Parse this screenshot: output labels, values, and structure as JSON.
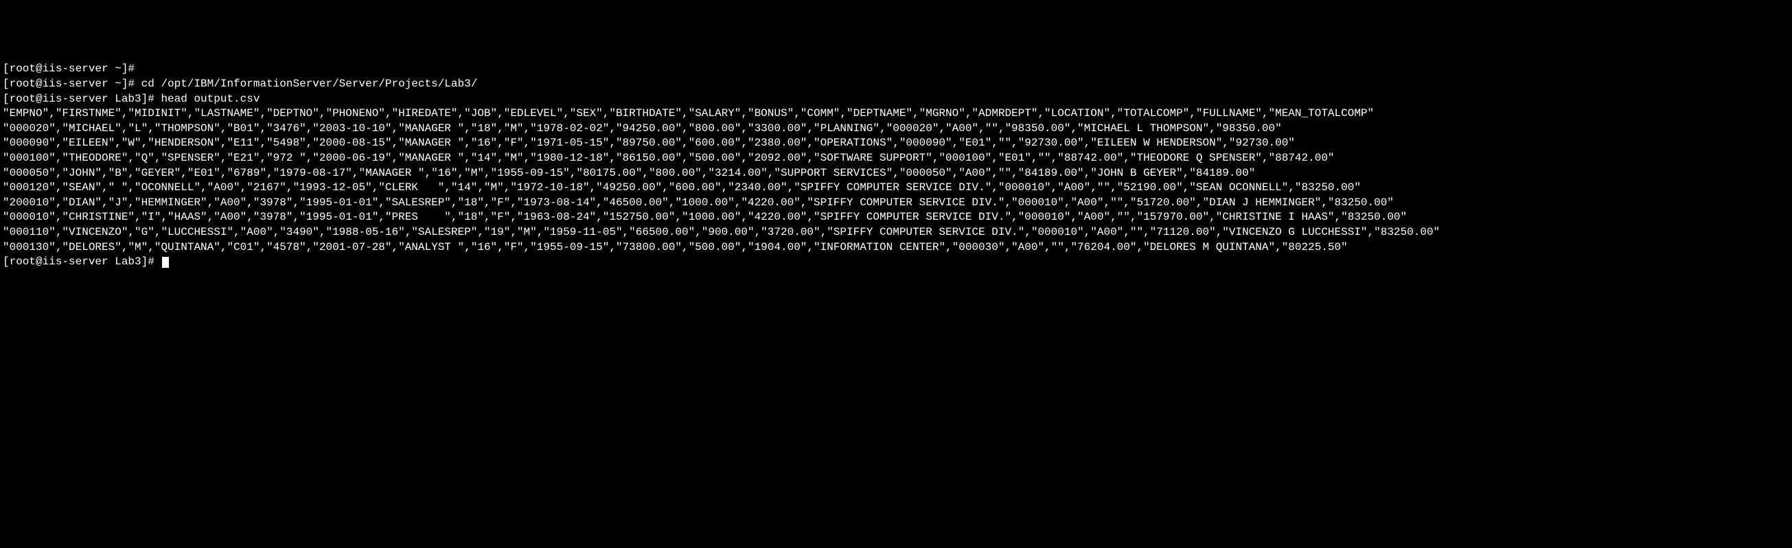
{
  "terminal": {
    "lines": [
      {
        "type": "prompt",
        "text": "[root@iis-server ~]#"
      },
      {
        "type": "prompt",
        "text": "[root@iis-server ~]# cd /opt/IBM/InformationServer/Server/Projects/Lab3/"
      },
      {
        "type": "prompt",
        "text": "[root@iis-server Lab3]# head output.csv"
      },
      {
        "type": "output",
        "text": "\"EMPNO\",\"FIRSTNME\",\"MIDINIT\",\"LASTNAME\",\"DEPTNO\",\"PHONENO\",\"HIREDATE\",\"JOB\",\"EDLEVEL\",\"SEX\",\"BIRTHDATE\",\"SALARY\",\"BONUS\",\"COMM\",\"DEPTNAME\",\"MGRNO\",\"ADMRDEPT\",\"LOCATION\",\"TOTALCOMP\",\"FULLNAME\",\"MEAN_TOTALCOMP\""
      },
      {
        "type": "output",
        "text": "\"000020\",\"MICHAEL\",\"L\",\"THOMPSON\",\"B01\",\"3476\",\"2003-10-10\",\"MANAGER \",\"18\",\"M\",\"1978-02-02\",\"94250.00\",\"800.00\",\"3300.00\",\"PLANNING\",\"000020\",\"A00\",\"\",\"98350.00\",\"MICHAEL L THOMPSON\",\"98350.00\""
      },
      {
        "type": "output",
        "text": "\"000090\",\"EILEEN\",\"W\",\"HENDERSON\",\"E11\",\"5498\",\"2000-08-15\",\"MANAGER \",\"16\",\"F\",\"1971-05-15\",\"89750.00\",\"600.00\",\"2380.00\",\"OPERATIONS\",\"000090\",\"E01\",\"\",\"92730.00\",\"EILEEN W HENDERSON\",\"92730.00\""
      },
      {
        "type": "output",
        "text": "\"000100\",\"THEODORE\",\"Q\",\"SPENSER\",\"E21\",\"972 \",\"2000-06-19\",\"MANAGER \",\"14\",\"M\",\"1980-12-18\",\"86150.00\",\"500.00\",\"2092.00\",\"SOFTWARE SUPPORT\",\"000100\",\"E01\",\"\",\"88742.00\",\"THEODORE Q SPENSER\",\"88742.00\""
      },
      {
        "type": "output",
        "text": "\"000050\",\"JOHN\",\"B\",\"GEYER\",\"E01\",\"6789\",\"1979-08-17\",\"MANAGER \",\"16\",\"M\",\"1955-09-15\",\"80175.00\",\"800.00\",\"3214.00\",\"SUPPORT SERVICES\",\"000050\",\"A00\",\"\",\"84189.00\",\"JOHN B GEYER\",\"84189.00\""
      },
      {
        "type": "output",
        "text": "\"000120\",\"SEAN\",\" \",\"OCONNELL\",\"A00\",\"2167\",\"1993-12-05\",\"CLERK   \",\"14\",\"M\",\"1972-10-18\",\"49250.00\",\"600.00\",\"2340.00\",\"SPIFFY COMPUTER SERVICE DIV.\",\"000010\",\"A00\",\"\",\"52190.00\",\"SEAN OCONNELL\",\"83250.00\""
      },
      {
        "type": "output",
        "text": "\"200010\",\"DIAN\",\"J\",\"HEMMINGER\",\"A00\",\"3978\",\"1995-01-01\",\"SALESREP\",\"18\",\"F\",\"1973-08-14\",\"46500.00\",\"1000.00\",\"4220.00\",\"SPIFFY COMPUTER SERVICE DIV.\",\"000010\",\"A00\",\"\",\"51720.00\",\"DIAN J HEMMINGER\",\"83250.00\""
      },
      {
        "type": "output",
        "text": "\"000010\",\"CHRISTINE\",\"I\",\"HAAS\",\"A00\",\"3978\",\"1995-01-01\",\"PRES    \",\"18\",\"F\",\"1963-08-24\",\"152750.00\",\"1000.00\",\"4220.00\",\"SPIFFY COMPUTER SERVICE DIV.\",\"000010\",\"A00\",\"\",\"157970.00\",\"CHRISTINE I HAAS\",\"83250.00\""
      },
      {
        "type": "output",
        "text": "\"000110\",\"VINCENZO\",\"G\",\"LUCCHESSI\",\"A00\",\"3490\",\"1988-05-16\",\"SALESREP\",\"19\",\"M\",\"1959-11-05\",\"66500.00\",\"900.00\",\"3720.00\",\"SPIFFY COMPUTER SERVICE DIV.\",\"000010\",\"A00\",\"\",\"71120.00\",\"VINCENZO G LUCCHESSI\",\"83250.00\""
      },
      {
        "type": "output",
        "text": "\"000130\",\"DELORES\",\"M\",\"QUINTANA\",\"C01\",\"4578\",\"2001-07-28\",\"ANALYST \",\"16\",\"F\",\"1955-09-15\",\"73800.00\",\"500.00\",\"1904.00\",\"INFORMATION CENTER\",\"000030\",\"A00\",\"\",\"76204.00\",\"DELORES M QUINTANA\",\"80225.50\""
      },
      {
        "type": "prompt-cursor",
        "text": "[root@iis-server Lab3]# "
      }
    ]
  }
}
